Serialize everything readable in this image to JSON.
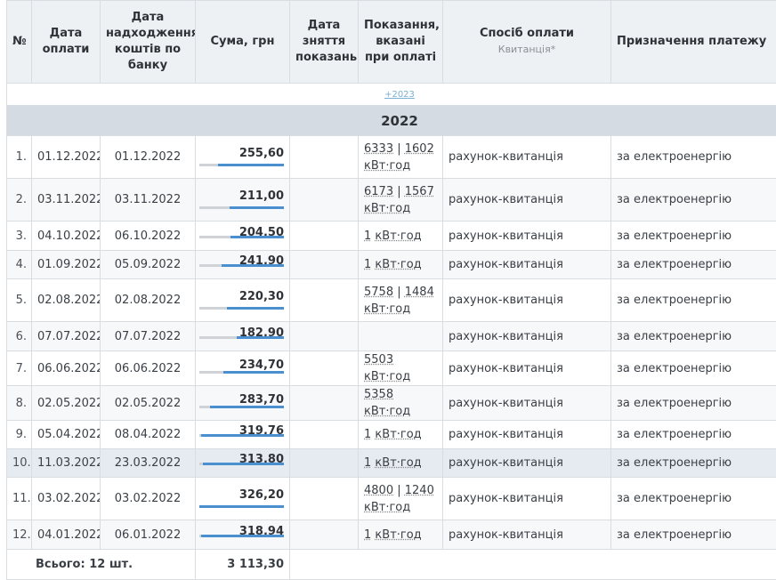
{
  "headers": {
    "num": "№",
    "pay_date": "Дата оплати",
    "bank_date": "Дата надходження коштів по банку",
    "sum": "Сума, грн",
    "read_date": "Дата зняття показань",
    "readings": "Показання, вказані при оплаті",
    "method": "Спосіб оплати",
    "method_sub": "Квитанція*",
    "purpose": "Призначення платежу"
  },
  "year_link": "+2023",
  "year": "2022",
  "unit": "кВт·год",
  "max_sum": 326.2,
  "rows": [
    {
      "n": "1.",
      "pay": "01.12.2022",
      "bank": "01.12.2022",
      "sum": "255,60",
      "v": 255.6,
      "r1": "6333",
      "r2": "1602",
      "method": "рахунок-квитанція",
      "purpose": "за електроенергію"
    },
    {
      "n": "2.",
      "pay": "03.11.2022",
      "bank": "03.11.2022",
      "sum": "211,00",
      "v": 211.0,
      "r1": "6173",
      "r2": "1567",
      "method": "рахунок-квитанція",
      "purpose": "за електроенергію"
    },
    {
      "n": "3.",
      "pay": "04.10.2022",
      "bank": "06.10.2022",
      "sum": "204,50",
      "v": 204.5,
      "r1": "1",
      "r2": "",
      "method": "рахунок-квитанція",
      "purpose": "за електроенергію"
    },
    {
      "n": "4.",
      "pay": "01.09.2022",
      "bank": "05.09.2022",
      "sum": "241,90",
      "v": 241.9,
      "r1": "1",
      "r2": "",
      "method": "рахунок-квитанція",
      "purpose": "за електроенергію"
    },
    {
      "n": "5.",
      "pay": "02.08.2022",
      "bank": "02.08.2022",
      "sum": "220,30",
      "v": 220.3,
      "r1": "5758",
      "r2": "1484",
      "method": "рахунок-квитанція",
      "purpose": "за електроенергію"
    },
    {
      "n": "6.",
      "pay": "07.07.2022",
      "bank": "07.07.2022",
      "sum": "182,90",
      "v": 182.9,
      "r1": "",
      "r2": "",
      "method": "рахунок-квитанція",
      "purpose": "за електроенергію"
    },
    {
      "n": "7.",
      "pay": "06.06.2022",
      "bank": "06.06.2022",
      "sum": "234,70",
      "v": 234.7,
      "r1": "5503",
      "r2": "",
      "method": "рахунок-квитанція",
      "purpose": "за електроенергію"
    },
    {
      "n": "8.",
      "pay": "02.05.2022",
      "bank": "02.05.2022",
      "sum": "283,70",
      "v": 283.7,
      "r1": "5358",
      "r2": "",
      "method": "рахунок-квитанція",
      "purpose": "за електроенергію"
    },
    {
      "n": "9.",
      "pay": "05.04.2022",
      "bank": "08.04.2022",
      "sum": "319,76",
      "v": 319.76,
      "r1": "1",
      "r2": "",
      "method": "рахунок-квитанція",
      "purpose": "за електроенергію"
    },
    {
      "n": "10.",
      "pay": "11.03.2022",
      "bank": "23.03.2022",
      "sum": "313,80",
      "v": 313.8,
      "r1": "1",
      "r2": "",
      "method": "рахунок-квитанція",
      "purpose": "за електроенергію"
    },
    {
      "n": "11.",
      "pay": "03.02.2022",
      "bank": "03.02.2022",
      "sum": "326,20",
      "v": 326.2,
      "r1": "4800",
      "r2": "1240",
      "method": "рахунок-квитанція",
      "purpose": "за електроенергію"
    },
    {
      "n": "12.",
      "pay": "04.01.2022",
      "bank": "06.01.2022",
      "sum": "318,94",
      "v": 318.94,
      "r1": "1",
      "r2": "",
      "method": "рахунок-квитанція",
      "purpose": "за електроенергію"
    }
  ],
  "total": {
    "label": "Всього: 12 шт.",
    "value": "3 113,30"
  }
}
